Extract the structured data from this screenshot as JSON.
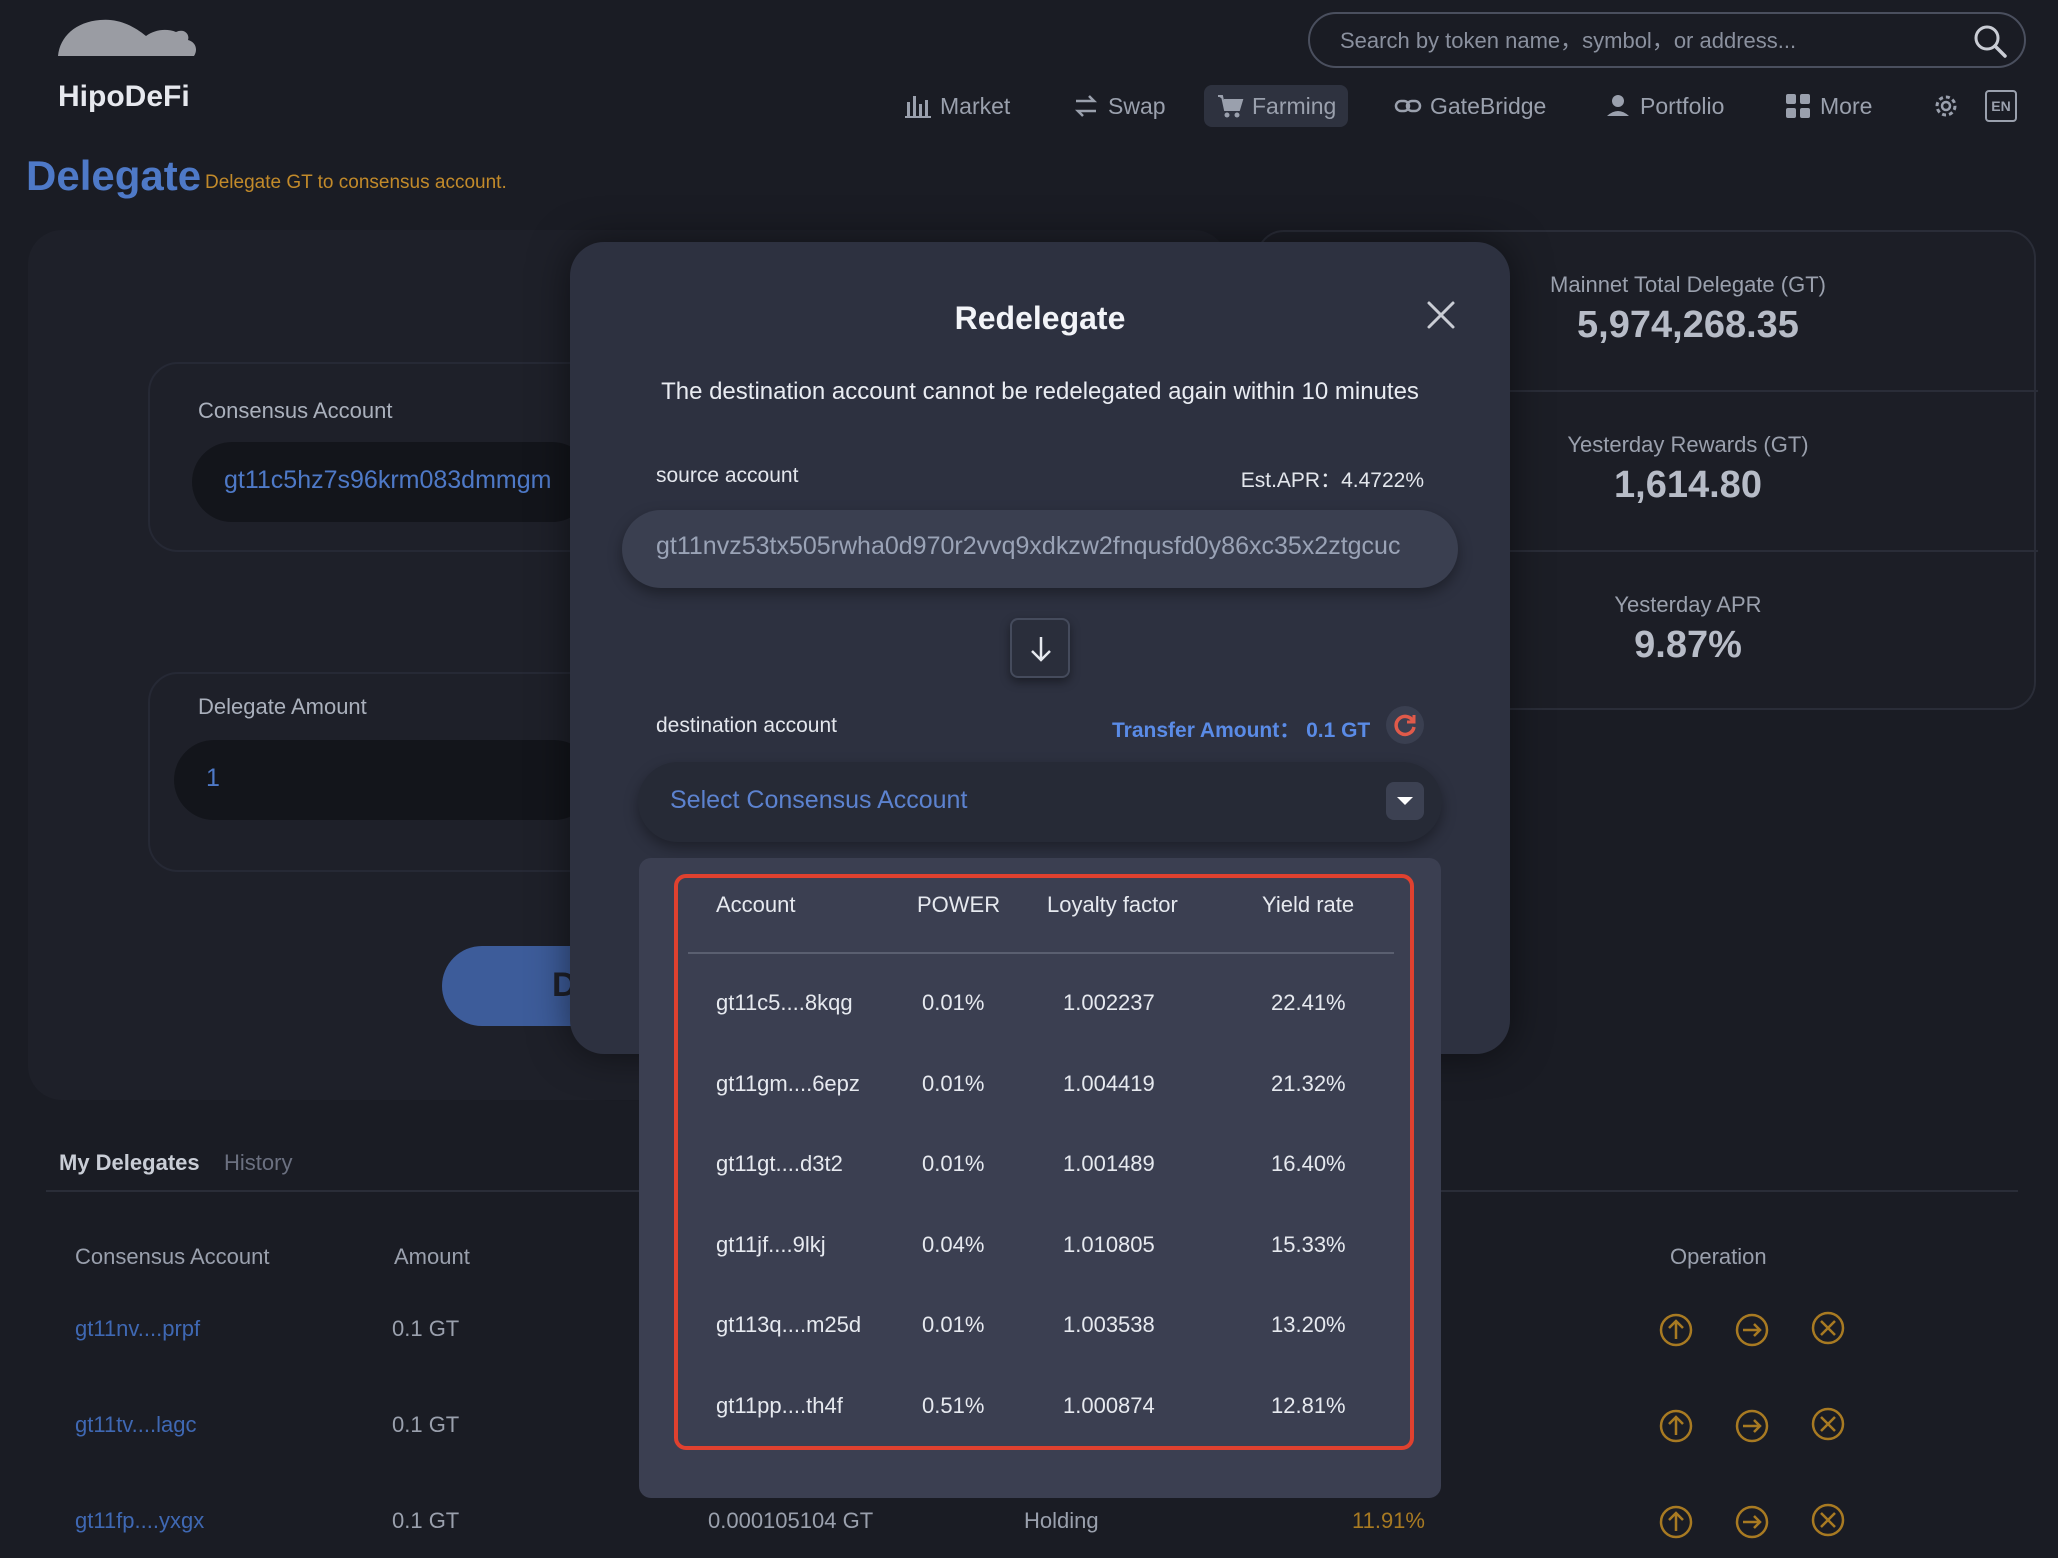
{
  "header": {
    "brand": "HipoDeFi",
    "search_placeholder": "Search by token name，symbol，or address...",
    "nav": [
      {
        "label": "Market",
        "icon": "bar-chart-icon"
      },
      {
        "label": "Swap",
        "icon": "swap-icon"
      },
      {
        "label": "Farming",
        "icon": "cart-icon",
        "active": true
      },
      {
        "label": "GateBridge",
        "icon": "link-icon"
      },
      {
        "label": "Portfolio",
        "icon": "portfolio-icon"
      },
      {
        "label": "More",
        "icon": "grid-icon"
      }
    ],
    "lang": "EN"
  },
  "page": {
    "title": "Delegate",
    "subtitle": "Delegate GT to consensus account."
  },
  "left_panel": {
    "consensus_label": "Consensus Account",
    "consensus_value": "gt11c5hz7s96krm083dmmgm",
    "amount_label": "Delegate Amount",
    "amount_value": "1",
    "button_label": "D"
  },
  "stats": [
    {
      "label": "Mainnet Total Delegate (GT)",
      "value": "5,974,268.35"
    },
    {
      "label": "Yesterday Rewards (GT)",
      "value": "1,614.80"
    },
    {
      "label": "Yesterday APR",
      "value": "9.87%"
    }
  ],
  "bottom": {
    "tabs": [
      "My Delegates",
      "History"
    ],
    "headers": {
      "account": "Consensus Account",
      "amount": "Amount",
      "operation": "Operation"
    },
    "rows": [
      {
        "account": "gt11nv....prpf",
        "amount": "0.1 GT"
      },
      {
        "account": "gt11tv....lagc",
        "amount": "0.1 GT"
      },
      {
        "account": "gt11fp....yxgx",
        "amount": "0.1 GT",
        "reward": "0.000105104 GT",
        "status": "Holding",
        "apr": "11.91%"
      }
    ]
  },
  "modal": {
    "title": "Redelegate",
    "warning": "The destination account cannot be redelegated again within 10 minutes",
    "source_label": "source account",
    "apr_text": "Est.APR：4.4722%",
    "source_value": "gt11nvz53tx505rwha0d970r2vvq9xdkzw2fnqusfd0y86xc35x2ztgcuc",
    "destination_label": "destination account",
    "transfer_text": "Transfer Amount：  0.1 GT",
    "select_placeholder": "Select Consensus Account"
  },
  "dropdown": {
    "headers": [
      "Account",
      "POWER",
      "Loyalty factor",
      "Yield rate"
    ],
    "rows": [
      [
        "gt11c5....8kqg",
        "0.01%",
        "1.002237",
        "22.41%"
      ],
      [
        "gt11gm....6epz",
        "0.01%",
        "1.004419",
        "21.32%"
      ],
      [
        "gt11gt....d3t2",
        "0.01%",
        "1.001489",
        "16.40%"
      ],
      [
        "gt11jf....9lkj",
        "0.04%",
        "1.010805",
        "15.33%"
      ],
      [
        "gt113q....m25d",
        "0.01%",
        "1.003538",
        "13.20%"
      ],
      [
        "gt11pp....th4f",
        "0.51%",
        "1.000874",
        "12.81%"
      ]
    ]
  },
  "colors": {
    "accent_blue": "#4e79c7",
    "accent_orange": "#c28a2a",
    "highlight_red": "#e0412f"
  }
}
